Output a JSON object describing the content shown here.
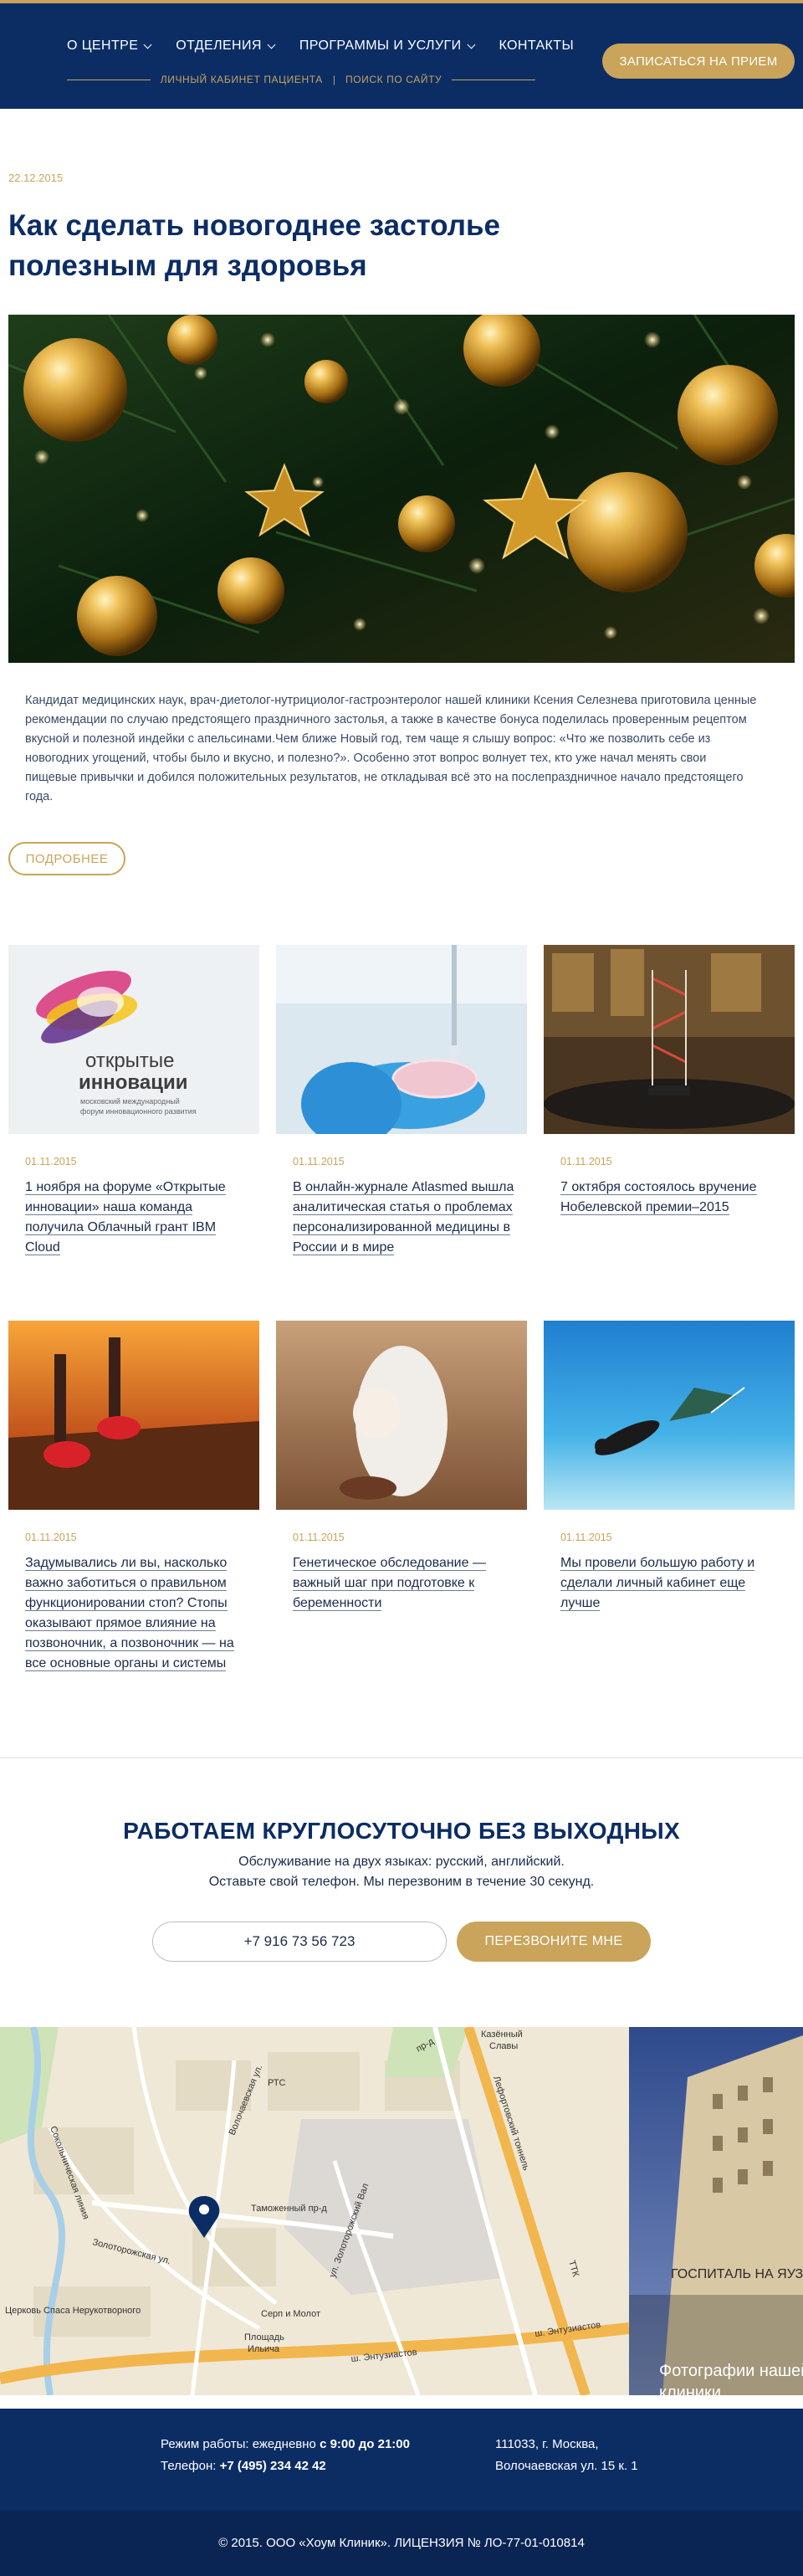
{
  "header": {
    "nav": [
      {
        "label": "О ЦЕНТРЕ",
        "has_dropdown": true
      },
      {
        "label": "ОТДЕЛЕНИЯ",
        "has_dropdown": true
      },
      {
        "label": "ПРОГРАММЫ И УСЛУГИ",
        "has_dropdown": true
      },
      {
        "label": "КОНТАКТЫ",
        "has_dropdown": false
      }
    ],
    "sublinks": [
      "ЛИЧНЫЙ КАБИНЕТ ПАЦИЕНТА",
      "ПОИСК ПО САЙТУ"
    ],
    "cta": "ЗАПИСАТЬСЯ НА ПРИЕМ"
  },
  "article": {
    "date": "22.12.2015",
    "title": "Как сделать новогоднее застолье полезным для здоровья",
    "intro": "Кандидат медицинских наук, врач-диетолог-нутрициолог-гастроэнтеролог нашей клиники Ксения Селезнева приготовила ценные рекомендации по случаю предстоящего праздничного застолья, а также в качестве бонуса поделилась проверенным рецептом вкусной и полезной индейки с апельсинами.Чем ближе Новый год, тем чаще я слышу вопрос: «Что же позволить себе из новогодних угощений, чтобы было и вкусно, и полезно?». Особенно этот вопрос волнует тех, кто уже начал менять свои пищевые привычки и добился положительных результатов, не откладывая всё это на послепраздничное начало предстоящего года.",
    "more": "ПОДРОБНЕЕ"
  },
  "cards": [
    {
      "date": "01.11.2015",
      "title": "1 ноября на форуме «Открытые инновации» наша команда получила Облачный грант IBM Cloud",
      "image": "open-innovations-logo"
    },
    {
      "date": "01.11.2015",
      "title": "В онлайн-журнале Atlasmed вышла аналитическая статья о проблемах персонализированной медицины в России и в мире",
      "image": "lab-pipette"
    },
    {
      "date": "01.11.2015",
      "title": "7 октября состоялось вручение Нобелевской премии–2015",
      "image": "dna-model-hall"
    },
    {
      "date": "01.11.2015",
      "title": "Задумывались ли вы, насколько важно заботиться о правильном функционировании стоп? Стопы оказывают прямое влияние на позвоночник, а позвоночник — на все основные органы и системы",
      "image": "running-feet"
    },
    {
      "date": "01.11.2015",
      "title": "Генетическое обследование — важный шаг при подготовке к беременности",
      "image": "pregnant-woman"
    },
    {
      "date": "01.11.2015",
      "title": "Мы провели большую работу и сделали личный кабинет еще лучше",
      "image": "diver-underwater"
    }
  ],
  "logo_card": {
    "line1": "открытые",
    "line2": "инновации",
    "sub1": "московский международный",
    "sub2": "форум инновационного развития"
  },
  "callback": {
    "title": "РАБОТАЕМ КРУГЛОСУТОЧНО БЕЗ ВЫХОДНЫХ",
    "sub1": "Обслуживание на двух языках: русский, английский.",
    "sub2": "Оставьте свой телефон. Мы перезвоним в течение 30 секунд.",
    "phone_value": "+7 916 73 56 723",
    "button": "ПЕРЕЗВОНИТЕ МНЕ"
  },
  "map": {
    "labels": {
      "sokolniki": "Сокольническая линия",
      "volochaevskaya": "Волочаевская ул.",
      "tamozhenny": "Таможенный пр-д",
      "zolotorozhsky": "ул. Золоторожский Вал",
      "lefortovo": "Лефортовский тоннель",
      "ttk": "ТТК",
      "entuziastov": "ш. Энтузиастов",
      "entuziastov2": "ш. Энтузиастов",
      "kazenny": "Казённый",
      "slavy": "Славы",
      "serp": "Серп и Молот",
      "ploshchad": "Площадь",
      "ilyicha": "Ильича",
      "church": "Церковь Спаса Нерукотворного",
      "zolotorozhskaya_ul": "Золоторожская ул.",
      "pr_d": "пр-д",
      "rtc": "РТС"
    },
    "photo_label": "Фотографии нашей клиники",
    "photo_sign": "ГОСПИТАЛЬ НА ЯУЗЕ"
  },
  "footer": {
    "hours_prefix": "Режим работы: ежедневно",
    "hours_value": "с 9:00 до 21:00",
    "phone_prefix": "Телефон:",
    "phone_value": "+7 (495) 234 42 42",
    "address1": "111033, г. Москва,",
    "address2": "Волочаевская ул. 15 к. 1",
    "copyright": "© 2015. ООО «Хоум Клиник». ЛИЦЕНЗИЯ № ЛО-77-01-010814"
  },
  "colors": {
    "brand_navy": "#0b2d64",
    "accent_gold": "#c9a45a"
  }
}
